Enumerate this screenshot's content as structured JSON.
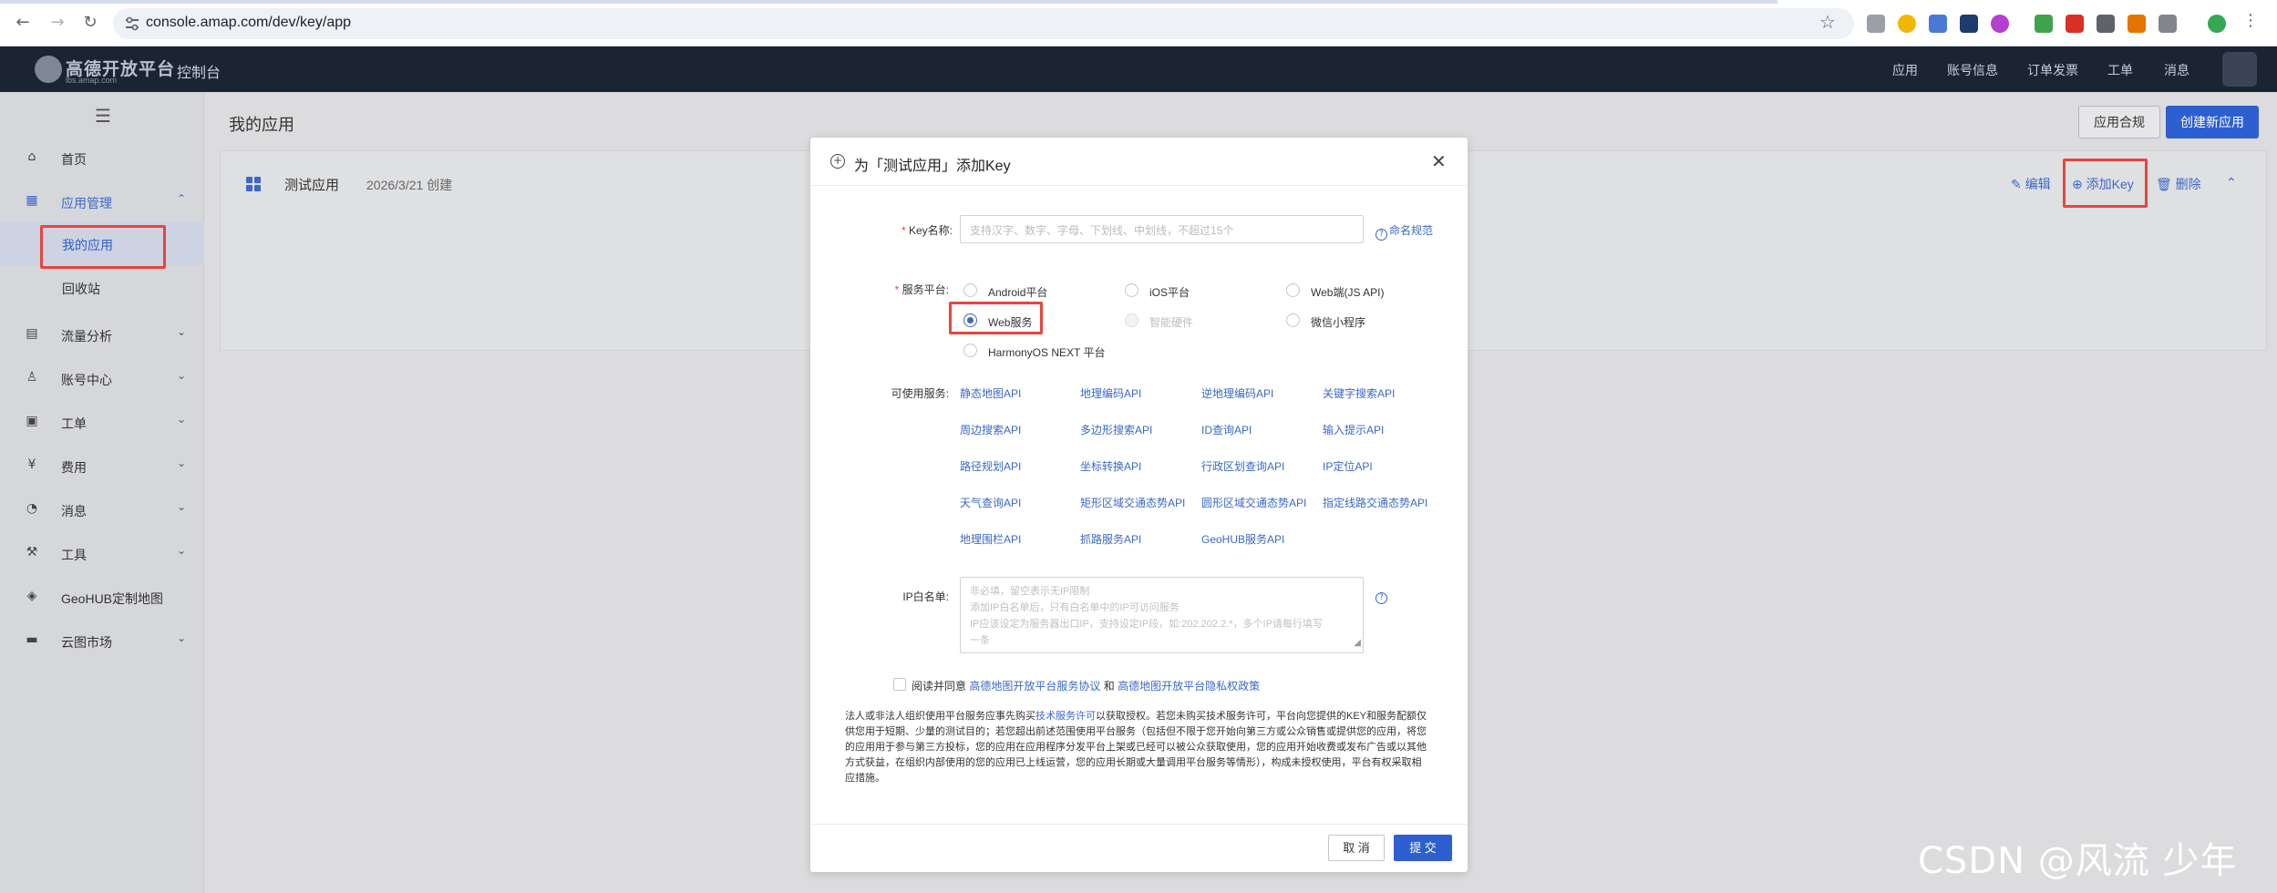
{
  "browser": {
    "url": "console.amap.com/dev/key/app"
  },
  "header": {
    "logo_text": "高德开放平台",
    "logo_sub": "lbs.amap.com",
    "console": "控制台",
    "nav": [
      "应用",
      "账号信息",
      "订单发票",
      "工单",
      "消息"
    ]
  },
  "sidebar": {
    "items": [
      {
        "icon": "home-icon",
        "label": "首页"
      },
      {
        "icon": "apps-icon",
        "label": "应用管理"
      },
      {
        "label": "我的应用"
      },
      {
        "label": "回收站"
      },
      {
        "icon": "analytics-icon",
        "label": "流量分析"
      },
      {
        "icon": "account-icon",
        "label": "账号中心"
      },
      {
        "icon": "ticket-icon",
        "label": "工单"
      },
      {
        "icon": "billing-icon",
        "label": "费用"
      },
      {
        "icon": "message-icon",
        "label": "消息"
      },
      {
        "icon": "tools-icon",
        "label": "工具"
      },
      {
        "icon": "geohub-icon",
        "label": "GeoHUB定制地图"
      },
      {
        "icon": "cloud-market-icon",
        "label": "云图市场"
      }
    ]
  },
  "main": {
    "title": "我的应用",
    "btn_compliance": "应用合规",
    "btn_create": "创建新应用",
    "app": {
      "name": "测试应用",
      "date": "2026/3/21 创建",
      "edit": "编辑",
      "add_key": "添加Key",
      "delete": "删除"
    }
  },
  "modal": {
    "title": "为「测试应用」添加Key",
    "key_label": "Key名称:",
    "key_placeholder": "支持汉字、数字、字母、下划线、中划线，不超过15个",
    "naming_rule": "命名规范",
    "platform_label": "服务平台:",
    "platforms": [
      {
        "label": "Android平台",
        "state": "normal"
      },
      {
        "label": "iOS平台",
        "state": "normal"
      },
      {
        "label": "Web端(JS API)",
        "state": "normal"
      },
      {
        "label": "Web服务",
        "state": "checked"
      },
      {
        "label": "智能硬件",
        "state": "disabled"
      },
      {
        "label": "微信小程序",
        "state": "normal"
      },
      {
        "label": "HarmonyOS NEXT 平台",
        "state": "normal"
      }
    ],
    "services_label": "可使用服务:",
    "services": [
      "静态地图API",
      "地理编码API",
      "逆地理编码API",
      "关键字搜索API",
      "周边搜索API",
      "多边形搜索API",
      "ID查询API",
      "输入提示API",
      "路径规划API",
      "坐标转换API",
      "行政区划查询API",
      "IP定位API",
      "天气查询API",
      "矩形区域交通态势API",
      "圆形区域交通态势API",
      "指定线路交通态势API",
      "地理围栏API",
      "抓路服务API",
      "GeoHUB服务API"
    ],
    "ip_label": "IP白名单:",
    "ip_placeholder_lines": [
      "非必填，留空表示无IP限制",
      "添加IP白名单后，只有白名单中的IP可访问服务",
      "IP应该设定为服务器出口IP，支持设定IP段，如:202.202.2.*，多个IP请每行填写",
      "一条"
    ],
    "agree_prefix": "阅读并同意",
    "agree_link1": "高德地图开放平台服务协议",
    "agree_and": "和",
    "agree_link2": "高德地图开放平台隐私权政策",
    "legal_part1": "法人或非法人组织使用平台服务应事先购买",
    "legal_link": "技术服务许可",
    "legal_part2": "以获取授权。若您未购买技术服务许可，平台向您提供的KEY和服务配额仅供您用于短期、少量的测试目的；若您超出前述范围使用平台服务（包括但不限于您开始向第三方或公众销售或提供您的应用，将您的应用用于参与第三方投标，您的应用在应用程序分发平台上架或已经可以被公众获取使用，您的应用开始收费或发布广告或以其他方式获益，在组织内部使用的您的应用已上线运营，您的应用长期或大量调用平台服务等情形），构成未授权使用，平台有权采取相应措施。",
    "btn_cancel": "取 消",
    "btn_submit": "提 交"
  },
  "watermark": "CSDN @风流 少年"
}
